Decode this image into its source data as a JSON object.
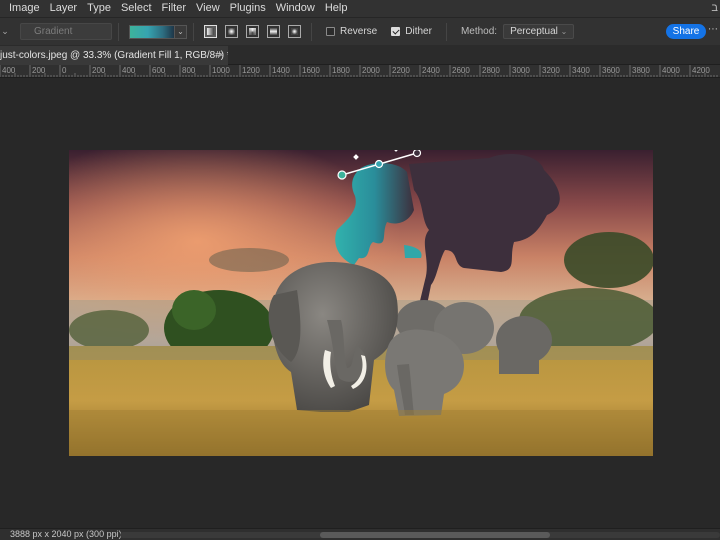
{
  "menubar": {
    "items": [
      "Image",
      "Layer",
      "Type",
      "Select",
      "Filter",
      "View",
      "Plugins",
      "Window",
      "Help"
    ],
    "more": "ב"
  },
  "options": {
    "preset_placeholder": "Gradient",
    "reverse_label": "Reverse",
    "reverse_checked": false,
    "dither_label": "Dither",
    "dither_checked": true,
    "method_label": "Method:",
    "method_value": "Perceptual",
    "share_label": "Share",
    "gradient_colors": [
      "#3db39b",
      "#36a4b0",
      "#2d6d80",
      "#1e3648"
    ]
  },
  "document": {
    "tab_title": "just-colors.jpeg @ 33.3% (Gradient Fill 1, RGB/8#) *",
    "close_glyph": "×"
  },
  "ruler": {
    "labels": [
      "400",
      "200",
      "0",
      "200",
      "400",
      "600",
      "800",
      "1000",
      "1200",
      "1400",
      "1600",
      "1800",
      "2000",
      "2200",
      "2400",
      "2600",
      "2800",
      "3000",
      "3200",
      "3400",
      "3600",
      "3800",
      "4000",
      "4200"
    ]
  },
  "status": {
    "doc_info": "3888 px x 2040 px (300 ppi)"
  }
}
